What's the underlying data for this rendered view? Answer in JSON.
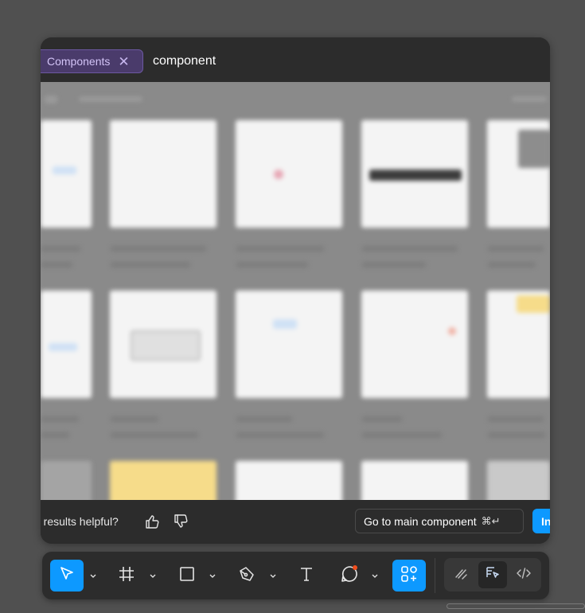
{
  "search": {
    "filter_chip": "Components",
    "chip_close_icon": "close-icon",
    "query": "component"
  },
  "footer": {
    "helpful_text": "se results helpful?",
    "thumbs_up_icon": "thumbs-up-icon",
    "thumbs_down_icon": "thumbs-down-icon",
    "goto_label": "Go to main component",
    "goto_shortcut": "⌘↵",
    "insert_label": "In"
  },
  "toolbar": {
    "tools": [
      {
        "name": "move-tool",
        "icon": "cursor-arrow-icon",
        "active": true
      },
      {
        "name": "frame-tool",
        "icon": "frame-hash-icon",
        "active": false
      },
      {
        "name": "shape-tool",
        "icon": "rectangle-icon",
        "active": false
      },
      {
        "name": "pen-tool",
        "icon": "pen-nib-icon",
        "active": false
      },
      {
        "name": "text-tool",
        "icon": "text-t-icon",
        "active": false
      },
      {
        "name": "comment-tool",
        "icon": "comment-bubble-icon",
        "active": false
      },
      {
        "name": "assets-tool",
        "icon": "assets-grid-icon",
        "active": true
      }
    ],
    "dev_tools": [
      {
        "name": "draw-mode",
        "icon": "squiggle-pen-icon",
        "active": false
      },
      {
        "name": "design-mode",
        "icon": "design-select-icon",
        "active": true
      },
      {
        "name": "dev-mode",
        "icon": "code-brackets-icon",
        "active": false
      }
    ]
  },
  "colors": {
    "accent": "#0d99ff",
    "chip_bg": "#4a3b6b",
    "chip_text": "#d3c4f7",
    "panel_bg": "#2c2c2c",
    "notification_dot": "#f24e1e"
  }
}
